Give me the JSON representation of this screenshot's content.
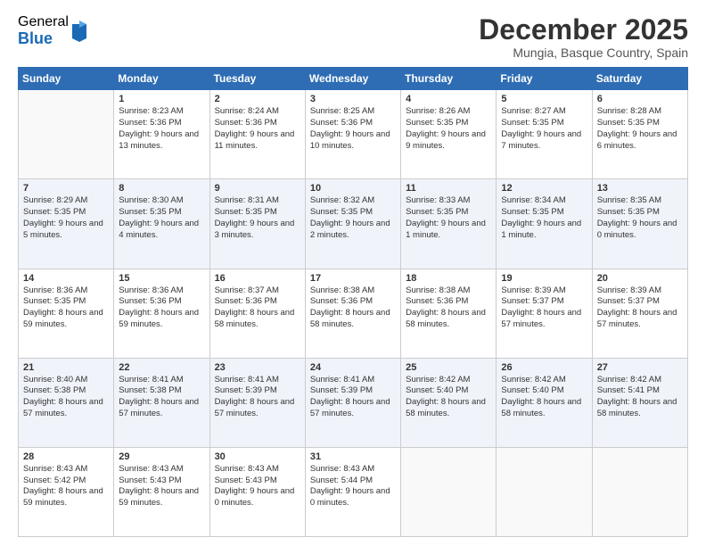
{
  "logo": {
    "general": "General",
    "blue": "Blue"
  },
  "title": "December 2025",
  "location": "Mungia, Basque Country, Spain",
  "headers": [
    "Sunday",
    "Monday",
    "Tuesday",
    "Wednesday",
    "Thursday",
    "Friday",
    "Saturday"
  ],
  "weeks": [
    [
      {
        "day": "",
        "sunrise": "",
        "sunset": "",
        "daylight": ""
      },
      {
        "day": "1",
        "sunrise": "Sunrise: 8:23 AM",
        "sunset": "Sunset: 5:36 PM",
        "daylight": "Daylight: 9 hours and 13 minutes."
      },
      {
        "day": "2",
        "sunrise": "Sunrise: 8:24 AM",
        "sunset": "Sunset: 5:36 PM",
        "daylight": "Daylight: 9 hours and 11 minutes."
      },
      {
        "day": "3",
        "sunrise": "Sunrise: 8:25 AM",
        "sunset": "Sunset: 5:36 PM",
        "daylight": "Daylight: 9 hours and 10 minutes."
      },
      {
        "day": "4",
        "sunrise": "Sunrise: 8:26 AM",
        "sunset": "Sunset: 5:35 PM",
        "daylight": "Daylight: 9 hours and 9 minutes."
      },
      {
        "day": "5",
        "sunrise": "Sunrise: 8:27 AM",
        "sunset": "Sunset: 5:35 PM",
        "daylight": "Daylight: 9 hours and 7 minutes."
      },
      {
        "day": "6",
        "sunrise": "Sunrise: 8:28 AM",
        "sunset": "Sunset: 5:35 PM",
        "daylight": "Daylight: 9 hours and 6 minutes."
      }
    ],
    [
      {
        "day": "7",
        "sunrise": "Sunrise: 8:29 AM",
        "sunset": "Sunset: 5:35 PM",
        "daylight": "Daylight: 9 hours and 5 minutes."
      },
      {
        "day": "8",
        "sunrise": "Sunrise: 8:30 AM",
        "sunset": "Sunset: 5:35 PM",
        "daylight": "Daylight: 9 hours and 4 minutes."
      },
      {
        "day": "9",
        "sunrise": "Sunrise: 8:31 AM",
        "sunset": "Sunset: 5:35 PM",
        "daylight": "Daylight: 9 hours and 3 minutes."
      },
      {
        "day": "10",
        "sunrise": "Sunrise: 8:32 AM",
        "sunset": "Sunset: 5:35 PM",
        "daylight": "Daylight: 9 hours and 2 minutes."
      },
      {
        "day": "11",
        "sunrise": "Sunrise: 8:33 AM",
        "sunset": "Sunset: 5:35 PM",
        "daylight": "Daylight: 9 hours and 1 minute."
      },
      {
        "day": "12",
        "sunrise": "Sunrise: 8:34 AM",
        "sunset": "Sunset: 5:35 PM",
        "daylight": "Daylight: 9 hours and 1 minute."
      },
      {
        "day": "13",
        "sunrise": "Sunrise: 8:35 AM",
        "sunset": "Sunset: 5:35 PM",
        "daylight": "Daylight: 9 hours and 0 minutes."
      }
    ],
    [
      {
        "day": "14",
        "sunrise": "Sunrise: 8:36 AM",
        "sunset": "Sunset: 5:35 PM",
        "daylight": "Daylight: 8 hours and 59 minutes."
      },
      {
        "day": "15",
        "sunrise": "Sunrise: 8:36 AM",
        "sunset": "Sunset: 5:36 PM",
        "daylight": "Daylight: 8 hours and 59 minutes."
      },
      {
        "day": "16",
        "sunrise": "Sunrise: 8:37 AM",
        "sunset": "Sunset: 5:36 PM",
        "daylight": "Daylight: 8 hours and 58 minutes."
      },
      {
        "day": "17",
        "sunrise": "Sunrise: 8:38 AM",
        "sunset": "Sunset: 5:36 PM",
        "daylight": "Daylight: 8 hours and 58 minutes."
      },
      {
        "day": "18",
        "sunrise": "Sunrise: 8:38 AM",
        "sunset": "Sunset: 5:36 PM",
        "daylight": "Daylight: 8 hours and 58 minutes."
      },
      {
        "day": "19",
        "sunrise": "Sunrise: 8:39 AM",
        "sunset": "Sunset: 5:37 PM",
        "daylight": "Daylight: 8 hours and 57 minutes."
      },
      {
        "day": "20",
        "sunrise": "Sunrise: 8:39 AM",
        "sunset": "Sunset: 5:37 PM",
        "daylight": "Daylight: 8 hours and 57 minutes."
      }
    ],
    [
      {
        "day": "21",
        "sunrise": "Sunrise: 8:40 AM",
        "sunset": "Sunset: 5:38 PM",
        "daylight": "Daylight: 8 hours and 57 minutes."
      },
      {
        "day": "22",
        "sunrise": "Sunrise: 8:41 AM",
        "sunset": "Sunset: 5:38 PM",
        "daylight": "Daylight: 8 hours and 57 minutes."
      },
      {
        "day": "23",
        "sunrise": "Sunrise: 8:41 AM",
        "sunset": "Sunset: 5:39 PM",
        "daylight": "Daylight: 8 hours and 57 minutes."
      },
      {
        "day": "24",
        "sunrise": "Sunrise: 8:41 AM",
        "sunset": "Sunset: 5:39 PM",
        "daylight": "Daylight: 8 hours and 57 minutes."
      },
      {
        "day": "25",
        "sunrise": "Sunrise: 8:42 AM",
        "sunset": "Sunset: 5:40 PM",
        "daylight": "Daylight: 8 hours and 58 minutes."
      },
      {
        "day": "26",
        "sunrise": "Sunrise: 8:42 AM",
        "sunset": "Sunset: 5:40 PM",
        "daylight": "Daylight: 8 hours and 58 minutes."
      },
      {
        "day": "27",
        "sunrise": "Sunrise: 8:42 AM",
        "sunset": "Sunset: 5:41 PM",
        "daylight": "Daylight: 8 hours and 58 minutes."
      }
    ],
    [
      {
        "day": "28",
        "sunrise": "Sunrise: 8:43 AM",
        "sunset": "Sunset: 5:42 PM",
        "daylight": "Daylight: 8 hours and 59 minutes."
      },
      {
        "day": "29",
        "sunrise": "Sunrise: 8:43 AM",
        "sunset": "Sunset: 5:43 PM",
        "daylight": "Daylight: 8 hours and 59 minutes."
      },
      {
        "day": "30",
        "sunrise": "Sunrise: 8:43 AM",
        "sunset": "Sunset: 5:43 PM",
        "daylight": "Daylight: 9 hours and 0 minutes."
      },
      {
        "day": "31",
        "sunrise": "Sunrise: 8:43 AM",
        "sunset": "Sunset: 5:44 PM",
        "daylight": "Daylight: 9 hours and 0 minutes."
      },
      {
        "day": "",
        "sunrise": "",
        "sunset": "",
        "daylight": ""
      },
      {
        "day": "",
        "sunrise": "",
        "sunset": "",
        "daylight": ""
      },
      {
        "day": "",
        "sunrise": "",
        "sunset": "",
        "daylight": ""
      }
    ]
  ]
}
